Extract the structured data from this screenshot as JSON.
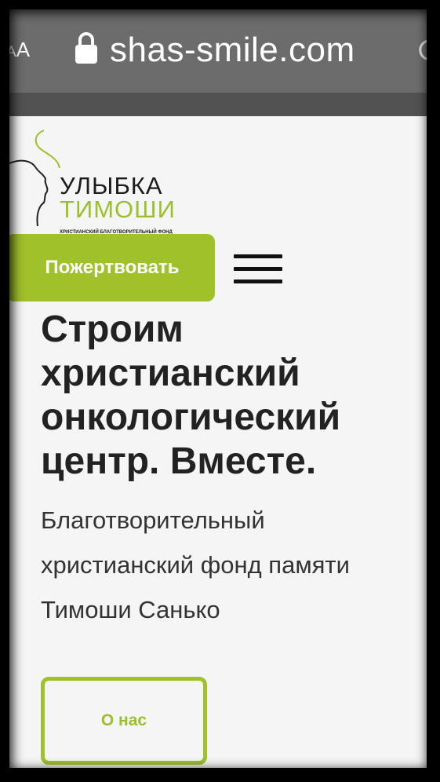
{
  "browser": {
    "text_size_label": "AA",
    "url_display": "shas-smile.com"
  },
  "logo": {
    "title_line1": "УЛЫБКА",
    "title_line2": "ТИМОШИ",
    "subtitle": "ХРИСТИАНСКИЙ БЛАГОТВОРИТЕЛЬНЫЙ ФОНД"
  },
  "header": {
    "donate_label": "Пожертвовать"
  },
  "hero": {
    "headline": "Строим христианский онкологический центр. Вместе.",
    "subline": "Благотворительный\nхристианский фонд памяти\nТимоши Санько",
    "about_label": "О нас"
  },
  "colors": {
    "accent": "#9fc12a",
    "headline": "#222222",
    "browser_bar": "#6c6c6c"
  }
}
